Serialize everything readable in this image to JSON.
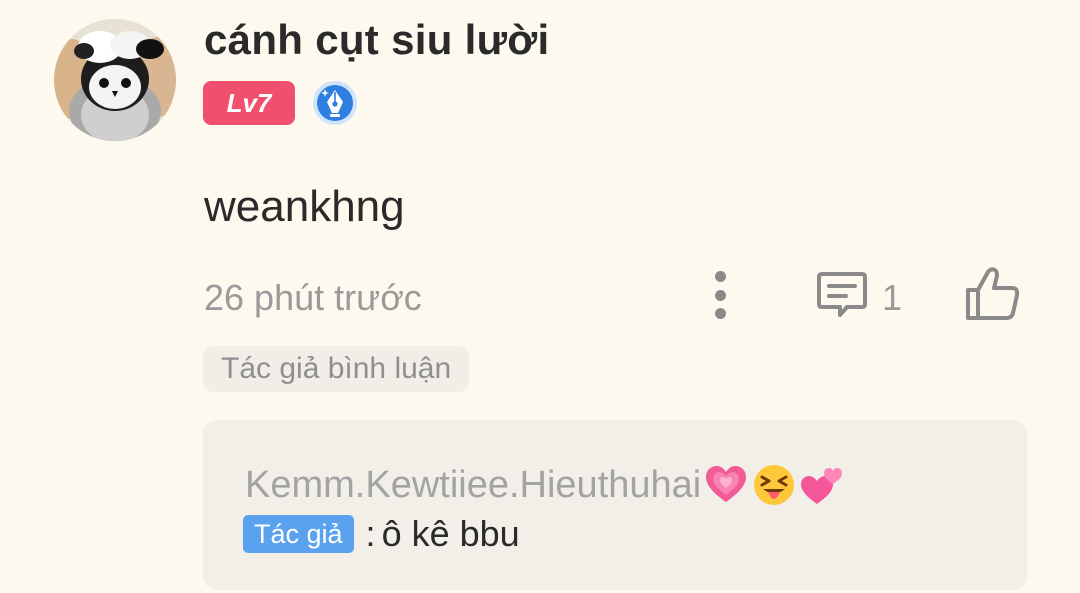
{
  "comment": {
    "username": "cánh cụt siu lười",
    "level_badge": "Lv7",
    "creator_badge_icon": "pen-nib-icon",
    "text": "weankhng",
    "timestamp": "26 phút trước",
    "reply_count": "1",
    "author_tag": "Tác giả bình luận"
  },
  "reply": {
    "author_name": "Kemm.Kewtiiee.Hieuthuhai",
    "author_emojis": [
      "growing-heart-emoji",
      "squinting-tongue-emoji",
      "two-hearts-emoji"
    ],
    "author_badge": "Tác giả",
    "separator": ":",
    "text": "ô kê bbu"
  },
  "colors": {
    "background": "#fdf9ef",
    "level_badge": "#f0506e",
    "author_badge": "#5aa2ee",
    "creator_badge": "#2f7fe0",
    "muted_text": "#9a9a9a"
  }
}
